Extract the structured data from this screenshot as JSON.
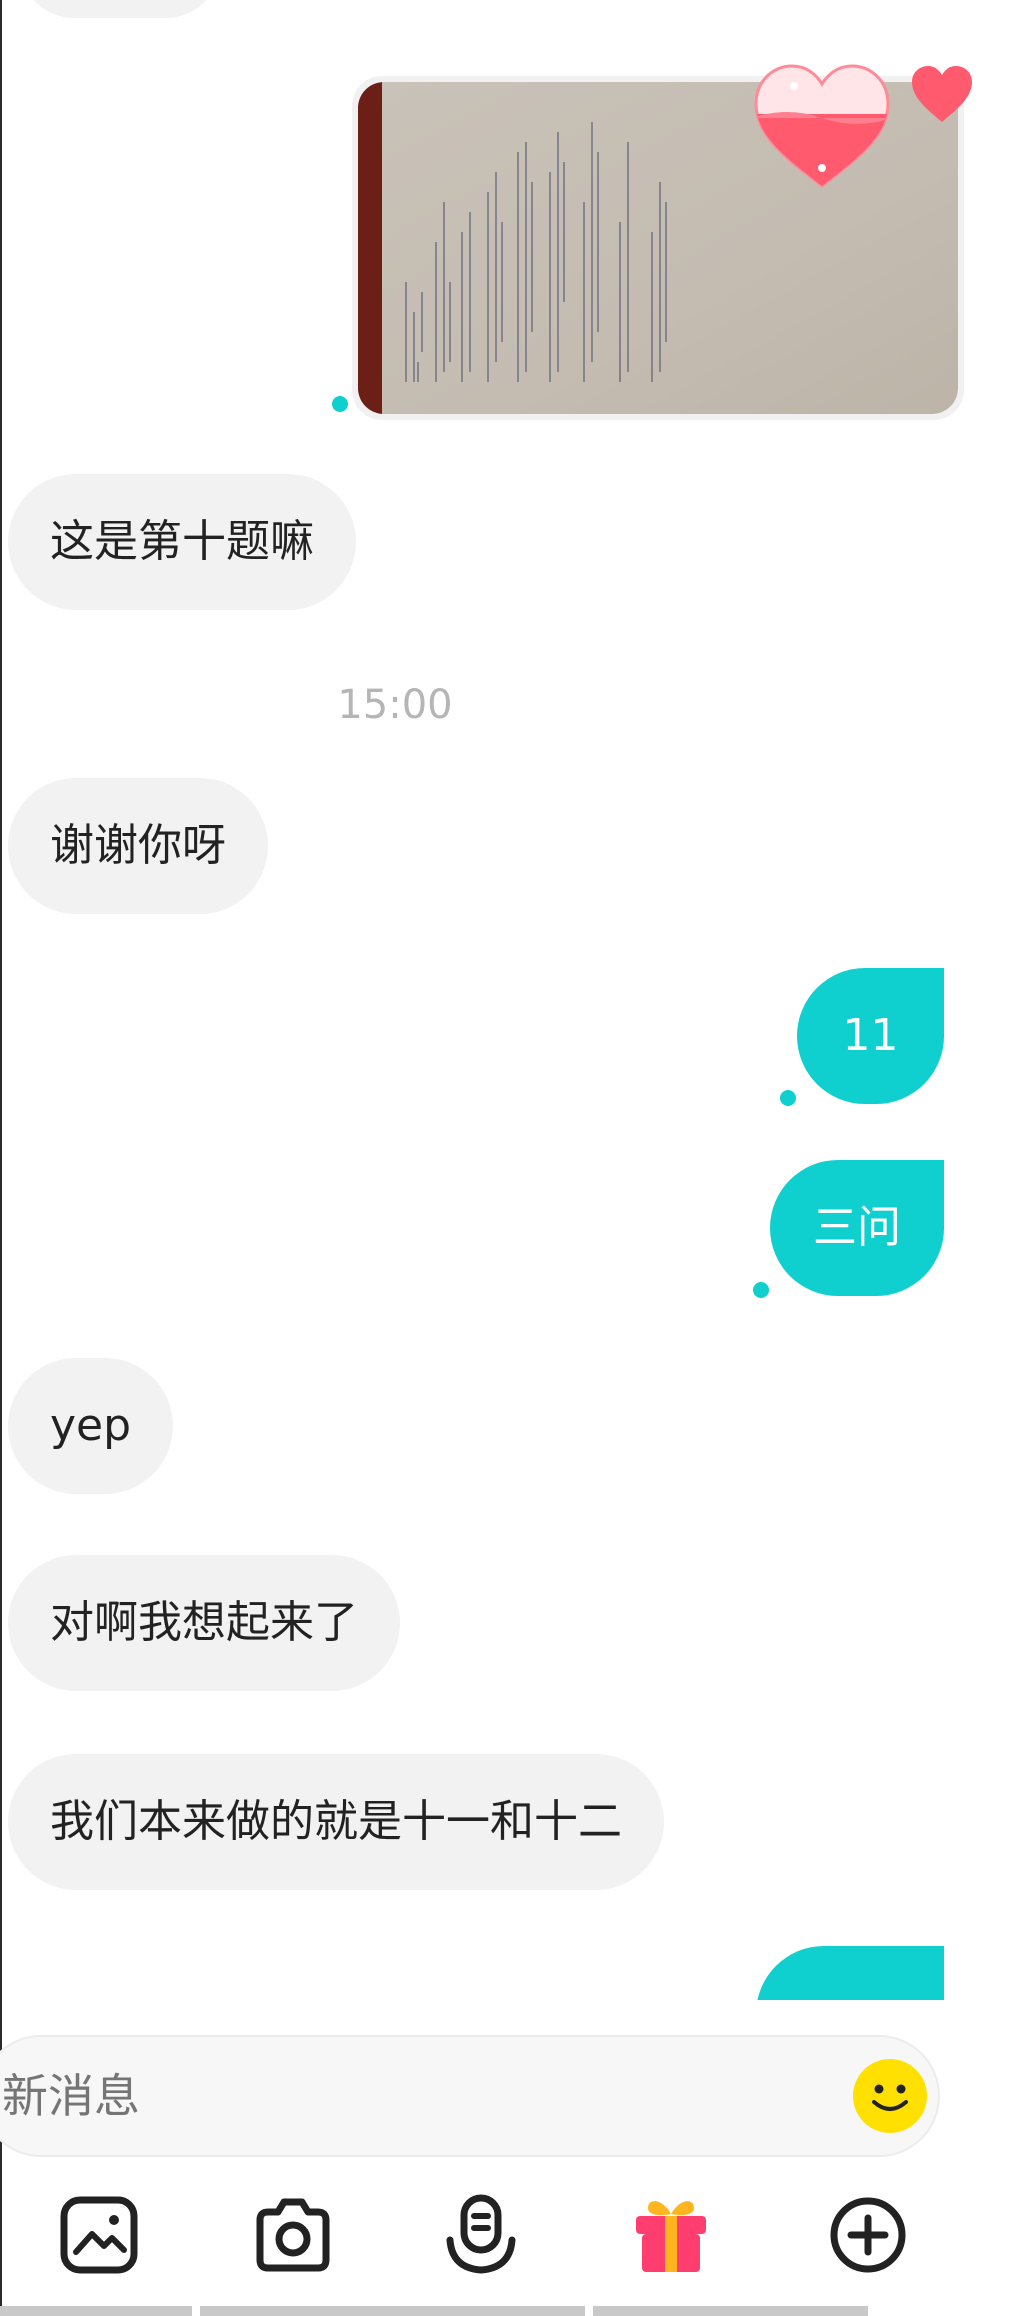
{
  "conversation": {
    "time_separator": "15:00",
    "messages": [
      {
        "side": "in",
        "text": "这是第十题嘛"
      },
      {
        "side": "in",
        "text": "谢谢你呀"
      },
      {
        "side": "out",
        "text": "11"
      },
      {
        "side": "out",
        "text": "三问"
      },
      {
        "side": "in",
        "text": "yep"
      },
      {
        "side": "in",
        "text": "对啊我想起来了"
      },
      {
        "side": "in",
        "text": "我们本来做的就是十一和十二"
      }
    ]
  },
  "composer": {
    "placeholder": "新消息"
  },
  "toolbar": {
    "items": [
      "image-icon",
      "camera-icon",
      "voice-icon",
      "gift-icon",
      "plus-icon"
    ]
  },
  "colors": {
    "accent": "#10cfcf",
    "incoming_bubble": "#f2f2f2",
    "heart": "#ff5a6e",
    "emoji": "#ffe000",
    "gift": "#ff3d6e"
  }
}
